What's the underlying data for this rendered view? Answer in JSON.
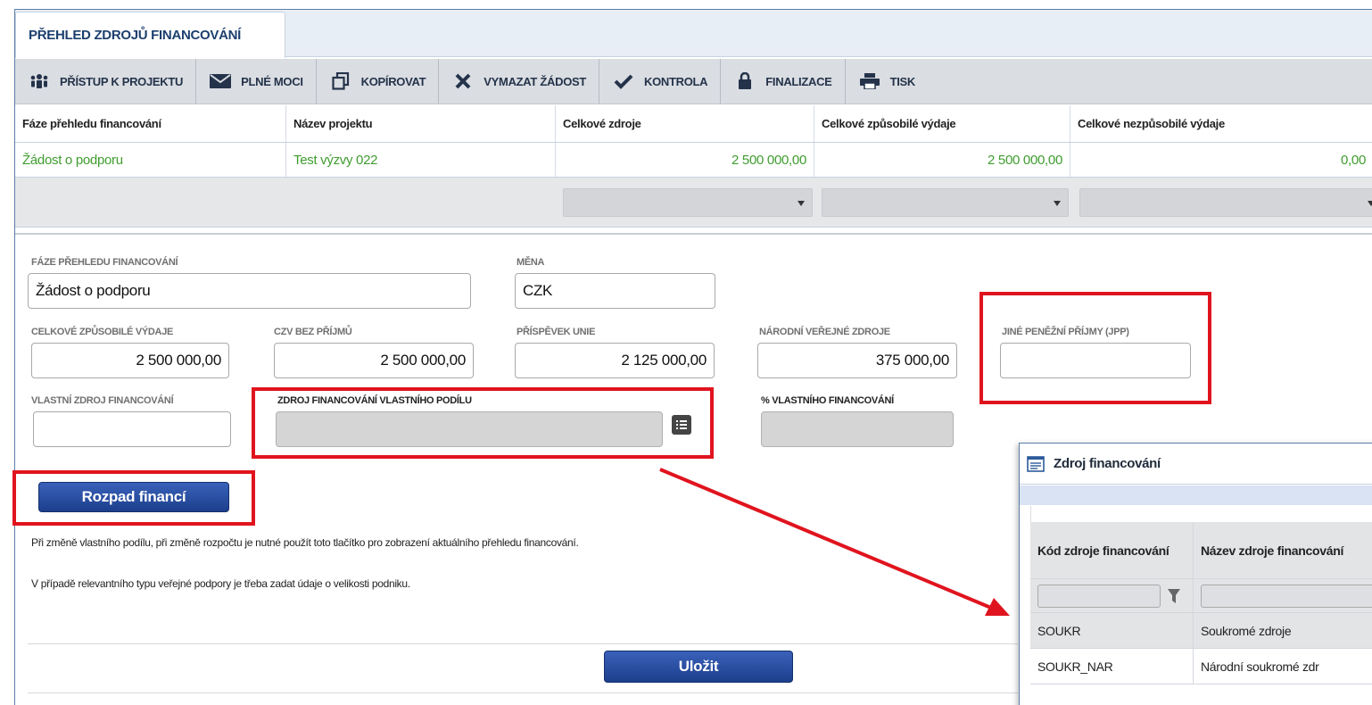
{
  "tab": {
    "title": "PŘEHLED ZDROJŮ FINANCOVÁNÍ"
  },
  "toolbar": [
    {
      "label": "PŘÍSTUP K PROJEKTU",
      "icon": "users-icon"
    },
    {
      "label": "PLNÉ MOCI",
      "icon": "envelope-icon"
    },
    {
      "label": "KOPÍROVAT",
      "icon": "copy-icon"
    },
    {
      "label": "VYMAZAT ŽÁDOST",
      "icon": "delete-icon"
    },
    {
      "label": "KONTROLA",
      "icon": "check-icon"
    },
    {
      "label": "FINALIZACE",
      "icon": "lock-icon"
    },
    {
      "label": "TISK",
      "icon": "print-icon"
    }
  ],
  "grid": {
    "headers": [
      "Fáze přehledu financování",
      "Název projektu",
      "Celkové zdroje",
      "Celkové způsobilé výdaje",
      "Celkové nezpůsobilé výdaje"
    ],
    "rows": [
      [
        "Žádost o podporu",
        "Test výzvy 022",
        "2 500 000,00",
        "2 500 000,00",
        "0,00"
      ]
    ]
  },
  "form": {
    "faze_label": "FÁZE PŘEHLEDU FINANCOVÁNÍ",
    "faze_value": "Žádost o podporu",
    "mena_label": "MĚNA",
    "mena_value": "CZK",
    "czv_label": "CELKOVÉ ZPŮSOBILÉ VÝDAJE",
    "czv_value": "2 500 000,00",
    "czv_bez_label": "CZV BEZ PŘÍJMŮ",
    "czv_bez_value": "2 500 000,00",
    "prispevek_label": "PŘÍSPĚVEK UNIE",
    "prispevek_value": "2 125 000,00",
    "narodni_label": "NÁRODNÍ VEŘEJNÉ ZDROJE",
    "narodni_value": "375 000,00",
    "jpp_label": "JINÉ PENĚŽNÍ PŘÍJMY (JPP)",
    "jpp_value": "",
    "vlastni_label": "VLASTNÍ ZDROJ FINANCOVÁNÍ",
    "vlastni_value": "",
    "zdroj_label": "ZDROJ FINANCOVÁNÍ VLASTNÍHO PODÍLU",
    "zdroj_value": "",
    "procento_label": "% VLASTNÍHO FINANCOVÁNÍ",
    "procento_value": ""
  },
  "buttons": {
    "rozpad": "Rozpad financí",
    "ulozit": "Uložit"
  },
  "notes": [
    "Při změně vlastního podílu, při změně rozpočtu je nutné použít toto tlačítko pro zobrazení aktuálního přehledu financování.",
    "V případě relevantního typu veřejné podpory je třeba zadat údaje o velikosti podniku."
  ],
  "dialog": {
    "title": "Zdroj financování",
    "headers": [
      "Kód zdroje financování",
      "Název zdroje financování"
    ],
    "rows": [
      [
        "SOUKR",
        "Soukromé zdroje"
      ],
      [
        "SOUKR_NAR",
        "Národní soukromé zdr"
      ]
    ]
  },
  "colors": {
    "highlight": "#e0141e",
    "accent": "#1d3f8c",
    "green_text": "#3f9d2f"
  }
}
